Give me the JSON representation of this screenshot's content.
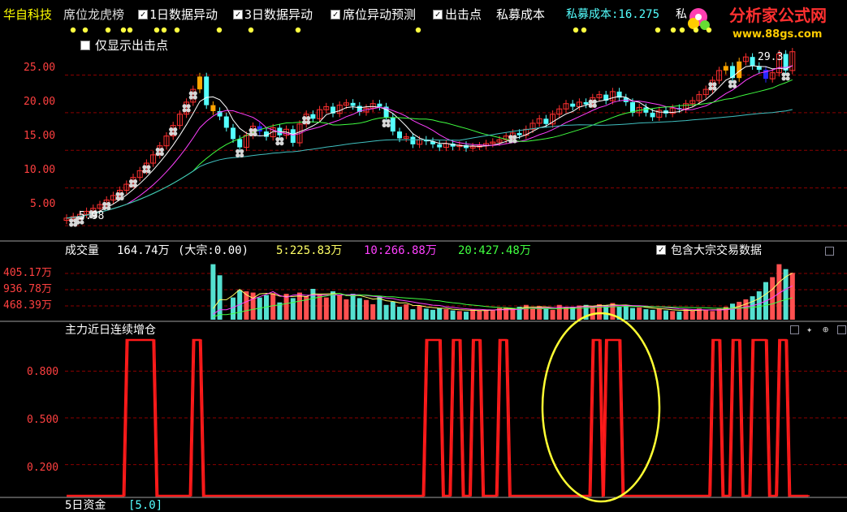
{
  "header": {
    "stock_name": "华自科技",
    "indicator_1": "席位龙虎榜",
    "checkboxes": [
      {
        "label": "1日数据异动",
        "checked": true
      },
      {
        "label": "3日数据异动",
        "checked": true
      },
      {
        "label": "席位异动预测",
        "checked": true
      },
      {
        "label": "出击点",
        "checked": true
      }
    ],
    "cost_label": "私募成本",
    "cost_value_text": "私募成本:16.275",
    "cost_cut": "私",
    "watermark_text": "分析家公式网",
    "watermark_url": "www.88gs.com",
    "only_show_label": "仅显示出击点",
    "only_show_checked": false
  },
  "colors": {
    "up": "#ff3030",
    "down": "#54ffff",
    "orange": "#ffa500",
    "blue": "#2828ff",
    "ma5": "#ffffff",
    "ma10": "#ff40ff",
    "ma20": "#40ff40",
    "ma60": "#40c0c0",
    "grid": "#8b0000",
    "indicator": "#ff1a1a",
    "circle": "#ffff33",
    "title_yellow": "#ffff00"
  },
  "price_pane": {
    "y_ticks": [
      "25.00",
      "20.00",
      "15.00",
      "10.00",
      "5.00"
    ],
    "low_label": "5.98",
    "high_label": "29.3",
    "y_range": [
      3.5,
      28.5
    ]
  },
  "volume_pane": {
    "title": "成交量",
    "value": "164.74万",
    "dazong": "(大宗:0.00)",
    "ma5": "5:225.83万",
    "ma10": "10:266.88万",
    "ma20": "20:427.48万",
    "include_label": "包含大宗交易数据",
    "include_checked": true,
    "y_ticks": [
      "405.17万",
      "936.78万",
      "468.39万"
    ]
  },
  "indicator_pane": {
    "title": "主力近日连续增仓",
    "y_ticks": [
      "0.800",
      "0.500",
      "0.200"
    ],
    "y_range": [
      0,
      1
    ]
  },
  "bottom_pane": {
    "title": "5日资金",
    "value": "[5.0]"
  },
  "chart_data": [
    {
      "type": "candlestick",
      "title": "",
      "ylim": [
        3.5,
        28.5
      ],
      "grid": true,
      "close": [
        6.0,
        6.2,
        6.5,
        6.9,
        7.3,
        7.8,
        8.4,
        9.0,
        9.7,
        10.5,
        11.4,
        12.3,
        13.3,
        14.4,
        15.6,
        16.9,
        18.3,
        19.8,
        21.4,
        23.1,
        24.8,
        21.0,
        20.2,
        19.5,
        18.0,
        16.5,
        15.4,
        17.0,
        18.2,
        17.5,
        16.8,
        18.0,
        17.0,
        17.8,
        16.0,
        18.5,
        19.8,
        19.2,
        20.4,
        20.8,
        19.9,
        21.0,
        21.3,
        20.9,
        20.1,
        20.6,
        21.2,
        20.8,
        19.4,
        17.5,
        16.6,
        16.8,
        15.8,
        16.4,
        16.2,
        15.8,
        15.4,
        15.9,
        15.5,
        15.7,
        15.3,
        15.5,
        15.6,
        15.9,
        16.1,
        16.4,
        16.9,
        17.3,
        17.0,
        17.8,
        18.6,
        19.2,
        18.5,
        19.8,
        20.5,
        21.2,
        20.8,
        21.4,
        21.1,
        22.0,
        22.4,
        21.6,
        22.8,
        22.0,
        21.4,
        20.0,
        20.7,
        20.0,
        19.4,
        20.3,
        19.9,
        20.6,
        20.5,
        21.2,
        21.6,
        22.4,
        23.1,
        24.3,
        25.6,
        26.2,
        24.6,
        26.8,
        27.4,
        26.2,
        25.7,
        24.5,
        25.3,
        27.8,
        25.6,
        28.1
      ],
      "ma5": [],
      "ma10": [],
      "ma20": [],
      "ma60": []
    },
    {
      "type": "bar",
      "title": "",
      "ylim": [
        0,
        1000
      ],
      "values": [
        0,
        0,
        0,
        0,
        0,
        0,
        0,
        0,
        0,
        0,
        0,
        0,
        0,
        0,
        0,
        0,
        0,
        0,
        0,
        0,
        0,
        0,
        900,
        720,
        0,
        360,
        480,
        460,
        440,
        360,
        400,
        430,
        280,
        420,
        350,
        440,
        380,
        500,
        410,
        360,
        460,
        400,
        330,
        420,
        350,
        320,
        250,
        380,
        240,
        290,
        210,
        250,
        170,
        230,
        180,
        160,
        190,
        170,
        150,
        140,
        130,
        170,
        150,
        160,
        160,
        190,
        200,
        180,
        210,
        240,
        190,
        220,
        180,
        160,
        240,
        200,
        210,
        230,
        240,
        220,
        250,
        230,
        270,
        210,
        230,
        190,
        200,
        170,
        160,
        180,
        150,
        140,
        130,
        170,
        150,
        180,
        160,
        140,
        180,
        210,
        260,
        290,
        330,
        380,
        460,
        610,
        690,
        900,
        820,
        760
      ]
    },
    {
      "type": "line",
      "title": "",
      "ylim": [
        0,
        1
      ],
      "segments": [
        [
          9,
          13
        ],
        [
          19,
          20
        ],
        [
          54,
          56
        ],
        [
          58,
          59
        ],
        [
          61,
          62
        ],
        [
          65,
          66
        ],
        [
          79,
          80
        ],
        [
          81,
          83
        ],
        [
          97,
          98
        ],
        [
          100,
          101
        ],
        [
          103,
          105
        ],
        [
          107,
          108
        ]
      ]
    }
  ]
}
